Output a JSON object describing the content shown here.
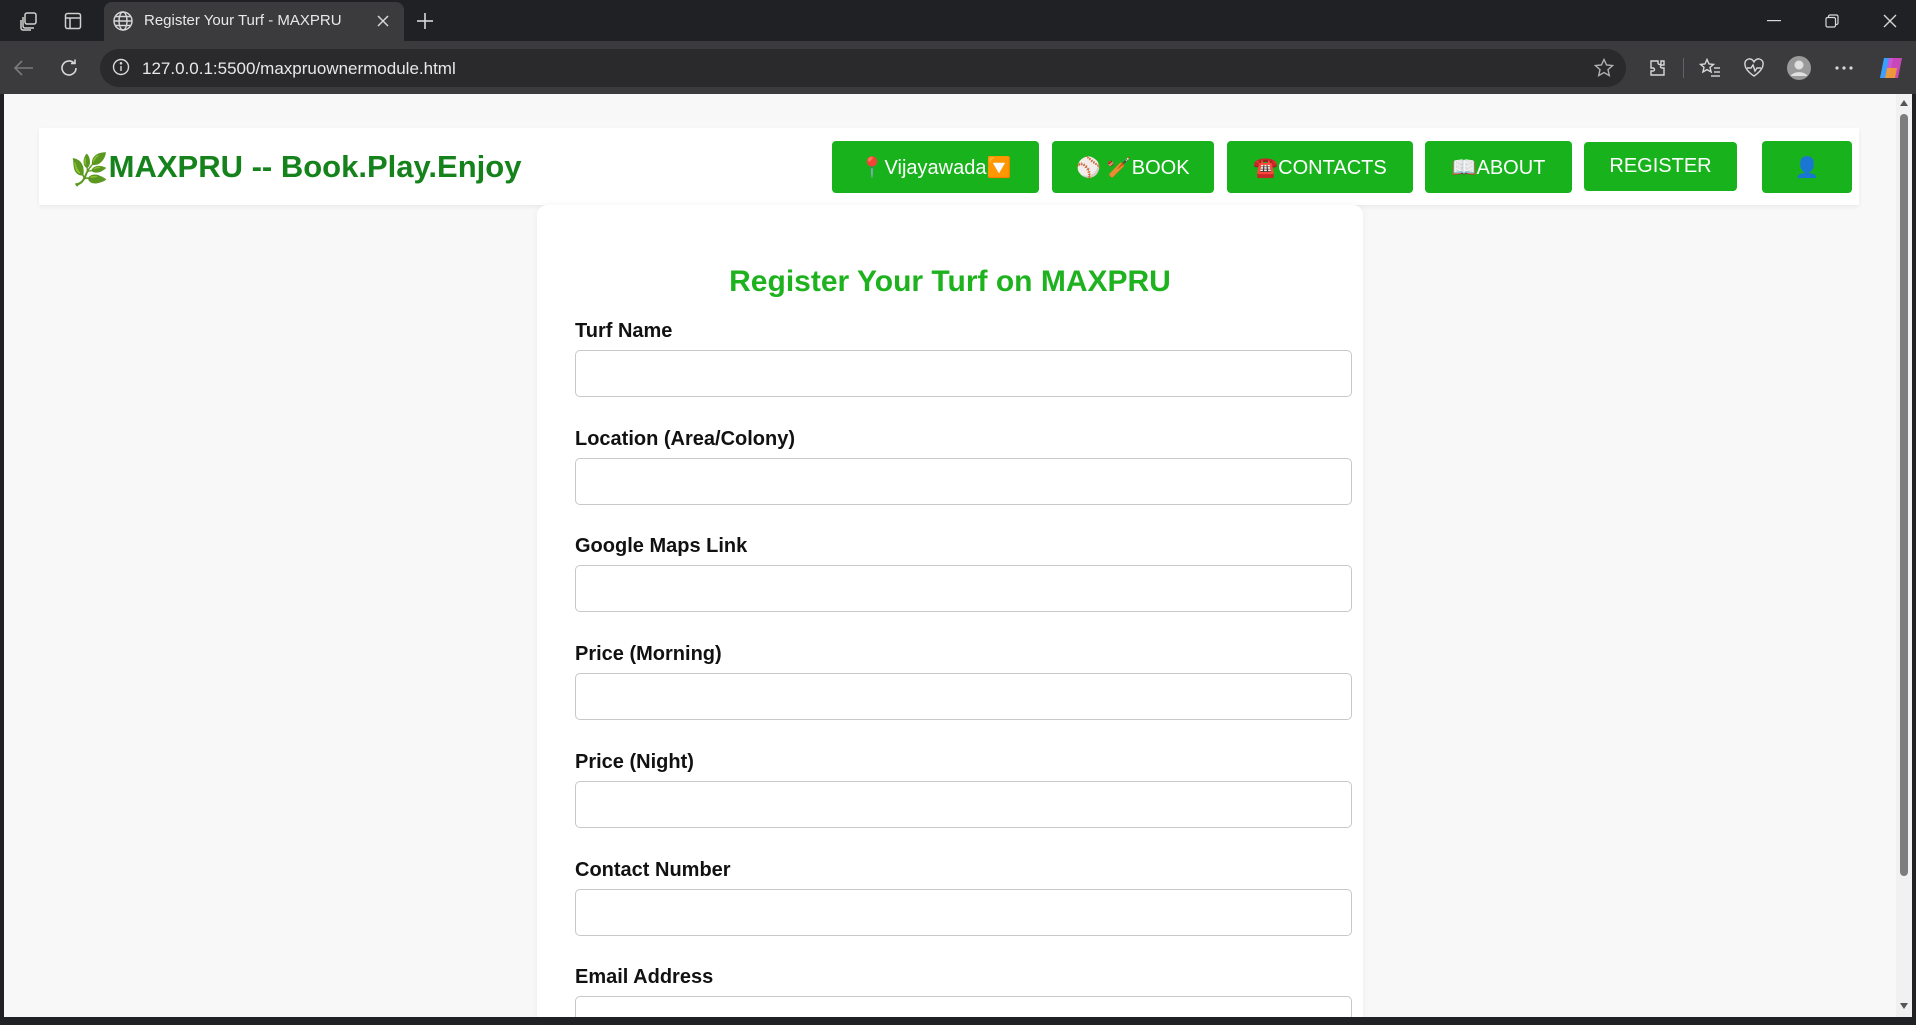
{
  "browser": {
    "tab_title": "Register Your Turf - MAXPRU",
    "url": "127.0.0.1:5500/maxpruownermodule.html"
  },
  "header": {
    "brand_icon": "🌿",
    "brand_text": "MAXPRU -- Book.Play.Enjoy",
    "buttons": {
      "location": "📍Vijayawada🔽",
      "book": "⚾ 🏏BOOK",
      "contacts": "☎️CONTACTS",
      "about": "📖ABOUT",
      "register": "REGISTER",
      "profile": "👤"
    }
  },
  "form": {
    "title": "Register Your Turf on MAXPRU",
    "fields": [
      {
        "label": "Turf Name",
        "value": ""
      },
      {
        "label": "Location (Area/Colony)",
        "value": ""
      },
      {
        "label": "Google Maps Link",
        "value": ""
      },
      {
        "label": "Price (Morning)",
        "value": ""
      },
      {
        "label": "Price (Night)",
        "value": ""
      },
      {
        "label": "Contact Number",
        "value": ""
      },
      {
        "label": "Email Address",
        "value": ""
      }
    ]
  },
  "colors": {
    "brand_green": "#15821c",
    "button_green": "#18b31c",
    "title_green": "#1fb21f"
  }
}
